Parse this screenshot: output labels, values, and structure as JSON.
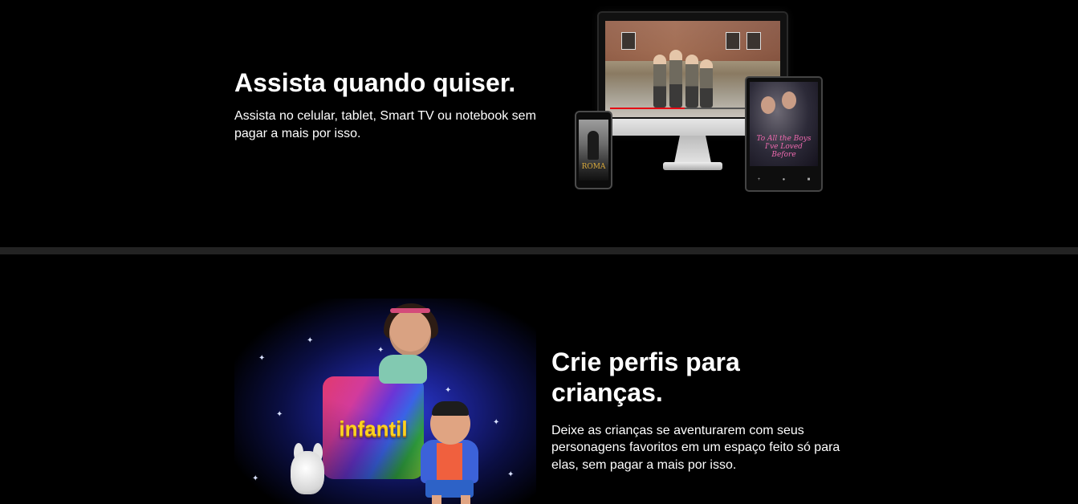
{
  "watch_section": {
    "title": "Assista quando quiser.",
    "description": "Assista no celular, tablet, Smart TV ou notebook sem pagar a mais por isso.",
    "devices": {
      "phone_poster_title": "ROMA",
      "tablet_poster_title": "To All the Boys I've Loved Before"
    }
  },
  "kids_section": {
    "title": "Crie perfis para crianças.",
    "description": "Deixe as crianças se aventurarem com seus personagens favoritos em um espaço feito só para elas, sem pagar a mais por isso.",
    "tile_label": "infantil"
  },
  "colors": {
    "background": "#000000",
    "divider": "#232323",
    "accent_red": "#e50914",
    "infantil_yellow": "#ffd21f"
  }
}
